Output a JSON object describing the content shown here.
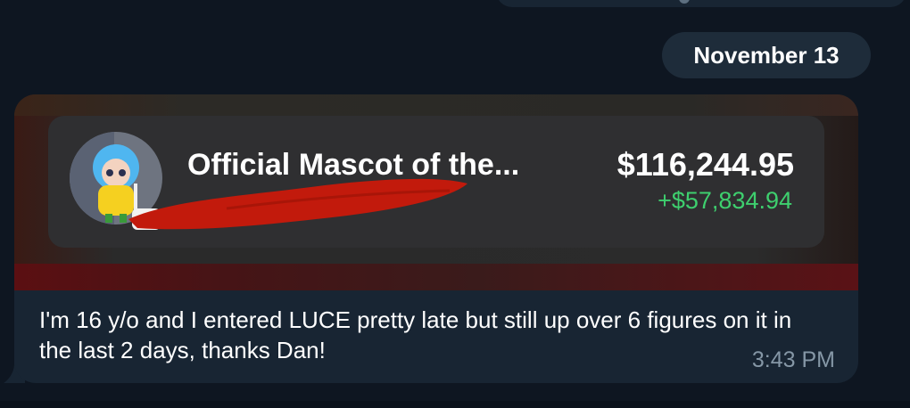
{
  "date_separator": "November 13",
  "message": {
    "card": {
      "title": "Official Mascot of the...",
      "amount": "$116,244.95",
      "gain": "+$57,834.94"
    },
    "text": "I'm 16 y/o and I entered LUCE pretty late but still up over 6 figures on it in the last 2 days, thanks Dan!",
    "time": "3:43 PM"
  },
  "colors": {
    "background": "#0e1621",
    "bubble": "#182533",
    "card": "#2f2f31",
    "gain": "#3ecf6e",
    "redaction": "#c21a0c",
    "timestamp": "#8597a6"
  },
  "icons": {
    "avatar": "mascot-avatar",
    "redaction": "red-redaction-scribble"
  }
}
